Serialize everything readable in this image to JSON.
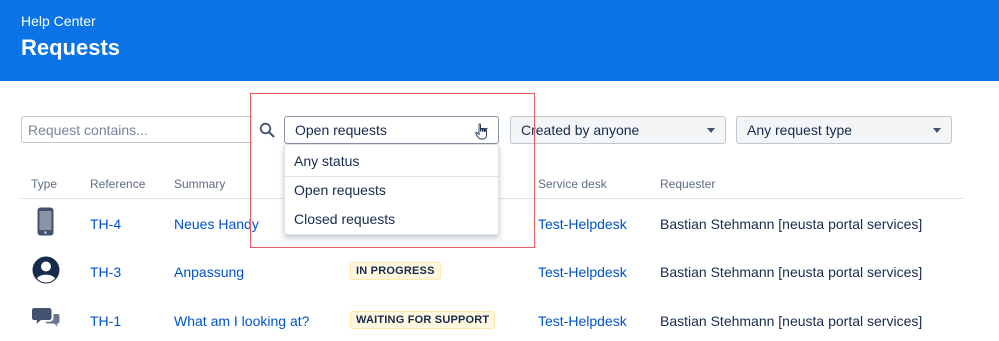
{
  "header": {
    "breadcrumb": "Help Center",
    "title": "Requests"
  },
  "filters": {
    "search_placeholder": "Request contains...",
    "status_selected": "Open requests",
    "creator_selected": "Created by anyone",
    "type_selected": "Any request type"
  },
  "status_menu": {
    "items": [
      "Any status",
      "Open requests",
      "Closed requests"
    ]
  },
  "table": {
    "columns": [
      "Type",
      "Reference",
      "Summary",
      "Service desk",
      "Requester"
    ],
    "rows": [
      {
        "type_icon": "mobile-phone-icon",
        "reference": "TH-4",
        "summary": "Neues Handy",
        "status": "",
        "service_desk": "Test-Helpdesk",
        "requester": "Bastian Stehmann [neusta portal services]"
      },
      {
        "type_icon": "user-avatar-icon",
        "reference": "TH-3",
        "summary": "Anpassung",
        "status": "IN PROGRESS",
        "service_desk": "Test-Helpdesk",
        "requester": "Bastian Stehmann [neusta portal services]"
      },
      {
        "type_icon": "chat-bubbles-icon",
        "reference": "TH-1",
        "summary": "What am I looking at?",
        "status": "WAITING FOR SUPPORT",
        "service_desk": "Test-Helpdesk",
        "requester": "Bastian Stehmann [neusta portal services]"
      }
    ]
  },
  "colors": {
    "header_bg": "#0a74e6",
    "link": "#0052cc",
    "highlight": "#e65c61",
    "lozenge_bg": "#fff7e0"
  }
}
